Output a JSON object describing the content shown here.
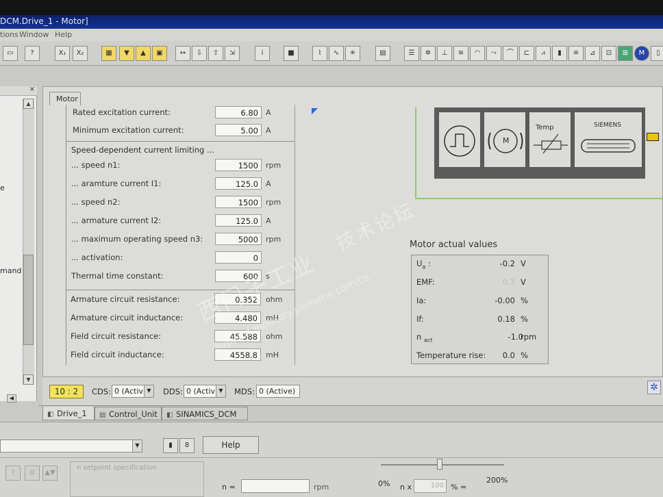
{
  "window": {
    "title": "DCM.Drive_1 - Motor]",
    "menu": [
      "tions",
      "Window",
      "Help"
    ]
  },
  "colors": {
    "title_bar": "#143394",
    "status_badge": "#f1e25d",
    "diagram_border": "#8ccf6b",
    "diagram_marker": "#e8c21a"
  },
  "left_pane": {
    "fragments": [
      "e",
      "mand"
    ]
  },
  "tab": {
    "label": "Motor"
  },
  "params": {
    "rated_excitation_current": {
      "label": "Rated excitation current:",
      "value": "6.80",
      "unit": "A"
    },
    "minimum_excitation_current": {
      "label": "Minimum excitation current:",
      "value": "5.00",
      "unit": "A"
    },
    "current_limiting_header": "Speed-dependent current limiting ...",
    "speed_n1": {
      "label": "... speed n1:",
      "value": "1500",
      "unit": "rpm"
    },
    "armature_current_i1": {
      "label": "... aramture current I1:",
      "value": "125.0",
      "unit": "A"
    },
    "speed_n2": {
      "label": "...  speed n2:",
      "value": "1500",
      "unit": "rpm"
    },
    "armature_current_i2": {
      "label": "... armature current I2:",
      "value": "125.0",
      "unit": "A"
    },
    "max_operating_speed_n3": {
      "label": "... maximum operating speed n3:",
      "value": "5000",
      "unit": "rpm"
    },
    "activation": {
      "label": "... activation:",
      "value": "0",
      "unit": ""
    },
    "thermal_time_constant": {
      "label": "Thermal time constant:",
      "value": "600",
      "unit": "s"
    },
    "armature_circuit_resistance": {
      "label": "Armature circuit resistance:",
      "value": "0.352",
      "unit": "ohm"
    },
    "armature_circuit_inductance": {
      "label": "Armature circuit inductance:",
      "value": "4.480",
      "unit": "mH"
    },
    "field_circuit_resistance": {
      "label": "Field circuit resistance:",
      "value": "45.588",
      "unit": "ohm"
    },
    "field_circuit_inductance": {
      "label": "Field circuit inductance:",
      "value": "4558.8",
      "unit": "mH"
    }
  },
  "diagram": {
    "motor_label": "M",
    "temp_label": "Temp",
    "brand_label": "SIEMENS"
  },
  "actual_values": {
    "title": "Motor actual values",
    "rows": [
      {
        "label": "U",
        "sub": "a",
        "value": "-0.2",
        "unit": "V"
      },
      {
        "label": "EMF:",
        "sub": "",
        "value": "0.3",
        "unit": "V"
      },
      {
        "label": "Ia:",
        "sub": "",
        "value": "-0.00",
        "unit": "%"
      },
      {
        "label": "If:",
        "sub": "",
        "value": "0.18",
        "unit": "%"
      },
      {
        "label": "n",
        "sub": "act",
        "value": "-1.0",
        "unit": "rpm"
      },
      {
        "label": "Temperature rise:",
        "sub": "",
        "value": "0.0",
        "unit": "%"
      }
    ]
  },
  "status": {
    "badge": "10 : 2",
    "cds_label": "CDS:",
    "cds_value": "0 (Activ",
    "dds_label": "DDS:",
    "dds_value": "0 (Activ",
    "mds_label": "MDS:",
    "mds_value": "0 (Active)"
  },
  "bottom_tabs": [
    {
      "label": "Drive_1"
    },
    {
      "label": "Control_Unit"
    },
    {
      "label": "SINAMICS_DCM"
    }
  ],
  "lower": {
    "help_label": "Help",
    "setpoint_placeholder": "n setpoint specification",
    "n_label": "n =",
    "rpm_label": "rpm",
    "pct_0": "0%",
    "pct_200": "200%",
    "nx_label": "n x",
    "nx_value": "100",
    "pct_eq": "% ="
  },
  "watermark": {
    "line1": "西门子工业",
    "line2": "support.industry.siemens.com/cs",
    "line3": "技术论坛"
  }
}
